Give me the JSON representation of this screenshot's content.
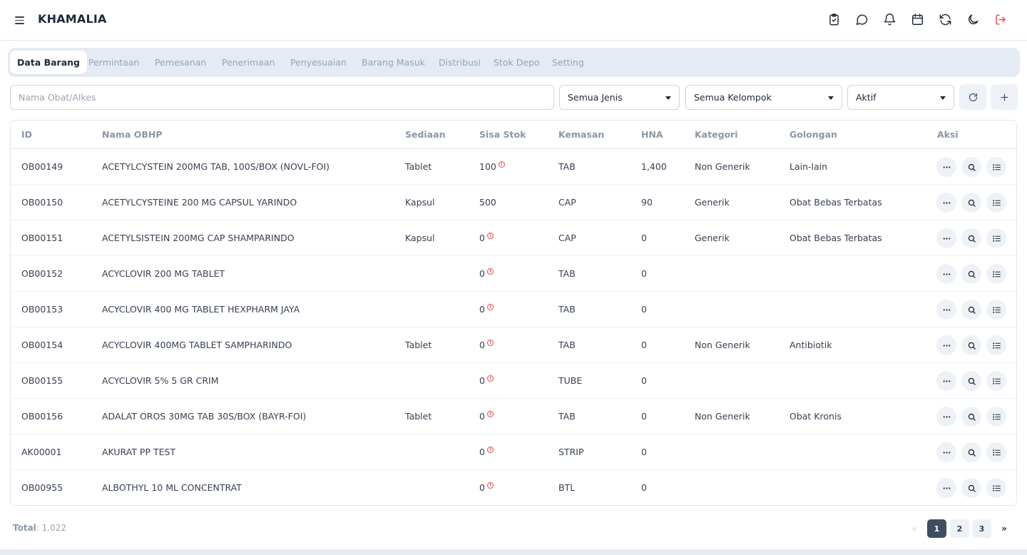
{
  "app": {
    "brand": "KHAMALIA"
  },
  "colors": {
    "accent": "#3f4d63",
    "logout": "#ef4444",
    "tab_bg": "#e5ebf4"
  },
  "header_icons": [
    "clipboard-check-icon",
    "chat-icon",
    "bell-icon",
    "calendar-icon",
    "refresh-icon",
    "moon-icon",
    "logout-icon"
  ],
  "tabs": [
    {
      "label": "Data Barang",
      "active": true
    },
    {
      "label": "Permintaan"
    },
    {
      "label": "Pemesanan"
    },
    {
      "label": "Penerimaan"
    },
    {
      "label": "Penyesuaian"
    },
    {
      "label": "Barang Masuk"
    },
    {
      "label": "Distribusi"
    },
    {
      "label": "Stok Depo"
    },
    {
      "label": "Setting"
    }
  ],
  "filters": {
    "search_placeholder": "Nama Obat/Alkes",
    "jenis": "Semua Jenis",
    "kelompok": "Semua Kelompok",
    "status": "Aktif"
  },
  "table": {
    "columns": [
      "ID",
      "Nama OBHP",
      "Sediaan",
      "Sisa Stok",
      "Kemasan",
      "HNA",
      "Kategori",
      "Golongan",
      "Aksi"
    ],
    "rows": [
      {
        "id": "OB00149",
        "nama": "ACETYLCYSTEIN 200MG TAB, 100S/BOX (NOVL-FOI)",
        "sediaan": "Tablet",
        "stok": "100",
        "warn": true,
        "kemasan": "TAB",
        "hna": "1,400",
        "kategori": "Non Generik",
        "golongan": "Lain-lain"
      },
      {
        "id": "OB00150",
        "nama": "ACETYLCYSTEINE 200 MG CAPSUL YARINDO",
        "sediaan": "Kapsul",
        "stok": "500",
        "warn": false,
        "kemasan": "CAP",
        "hna": "90",
        "kategori": "Generik",
        "golongan": "Obat Bebas Terbatas"
      },
      {
        "id": "OB00151",
        "nama": "ACETYLSISTEIN 200MG CAP SHAMPARINDO",
        "sediaan": "Kapsul",
        "stok": "0",
        "warn": true,
        "kemasan": "CAP",
        "hna": "0",
        "kategori": "Generik",
        "golongan": "Obat Bebas Terbatas"
      },
      {
        "id": "OB00152",
        "nama": "ACYCLOVIR 200 MG TABLET",
        "sediaan": "",
        "stok": "0",
        "warn": true,
        "kemasan": "TAB",
        "hna": "0",
        "kategori": "",
        "golongan": ""
      },
      {
        "id": "OB00153",
        "nama": "ACYCLOVIR 400 MG TABLET HEXPHARM JAYA",
        "sediaan": "",
        "stok": "0",
        "warn": true,
        "kemasan": "TAB",
        "hna": "0",
        "kategori": "",
        "golongan": ""
      },
      {
        "id": "OB00154",
        "nama": "ACYCLOVIR 400MG TABLET SAMPHARINDO",
        "sediaan": "Tablet",
        "stok": "0",
        "warn": true,
        "kemasan": "TAB",
        "hna": "0",
        "kategori": "Non Generik",
        "golongan": "Antibiotik"
      },
      {
        "id": "OB00155",
        "nama": "ACYCLOVIR 5% 5 GR CRIM",
        "sediaan": "",
        "stok": "0",
        "warn": true,
        "kemasan": "TUBE",
        "hna": "0",
        "kategori": "",
        "golongan": ""
      },
      {
        "id": "OB00156",
        "nama": "ADALAT OROS 30MG TAB 30S/BOX (BAYR-FOI)",
        "sediaan": "Tablet",
        "stok": "0",
        "warn": true,
        "kemasan": "TAB",
        "hna": "0",
        "kategori": "Non Generik",
        "golongan": "Obat Kronis"
      },
      {
        "id": "AK00001",
        "nama": "AKURAT PP TEST",
        "sediaan": "",
        "stok": "0",
        "warn": true,
        "kemasan": "STRIP",
        "hna": "0",
        "kategori": "",
        "golongan": ""
      },
      {
        "id": "OB00955",
        "nama": "ALBOTHYL 10 ML CONCENTRAT",
        "sediaan": "",
        "stok": "0",
        "warn": true,
        "kemasan": "BTL",
        "hna": "0",
        "kategori": "",
        "golongan": ""
      }
    ]
  },
  "footer": {
    "total_label": "Total",
    "total_value": ": 1.022",
    "pages": [
      "1",
      "2",
      "3"
    ],
    "current_page": "1",
    "prev": "«",
    "next": "»"
  }
}
